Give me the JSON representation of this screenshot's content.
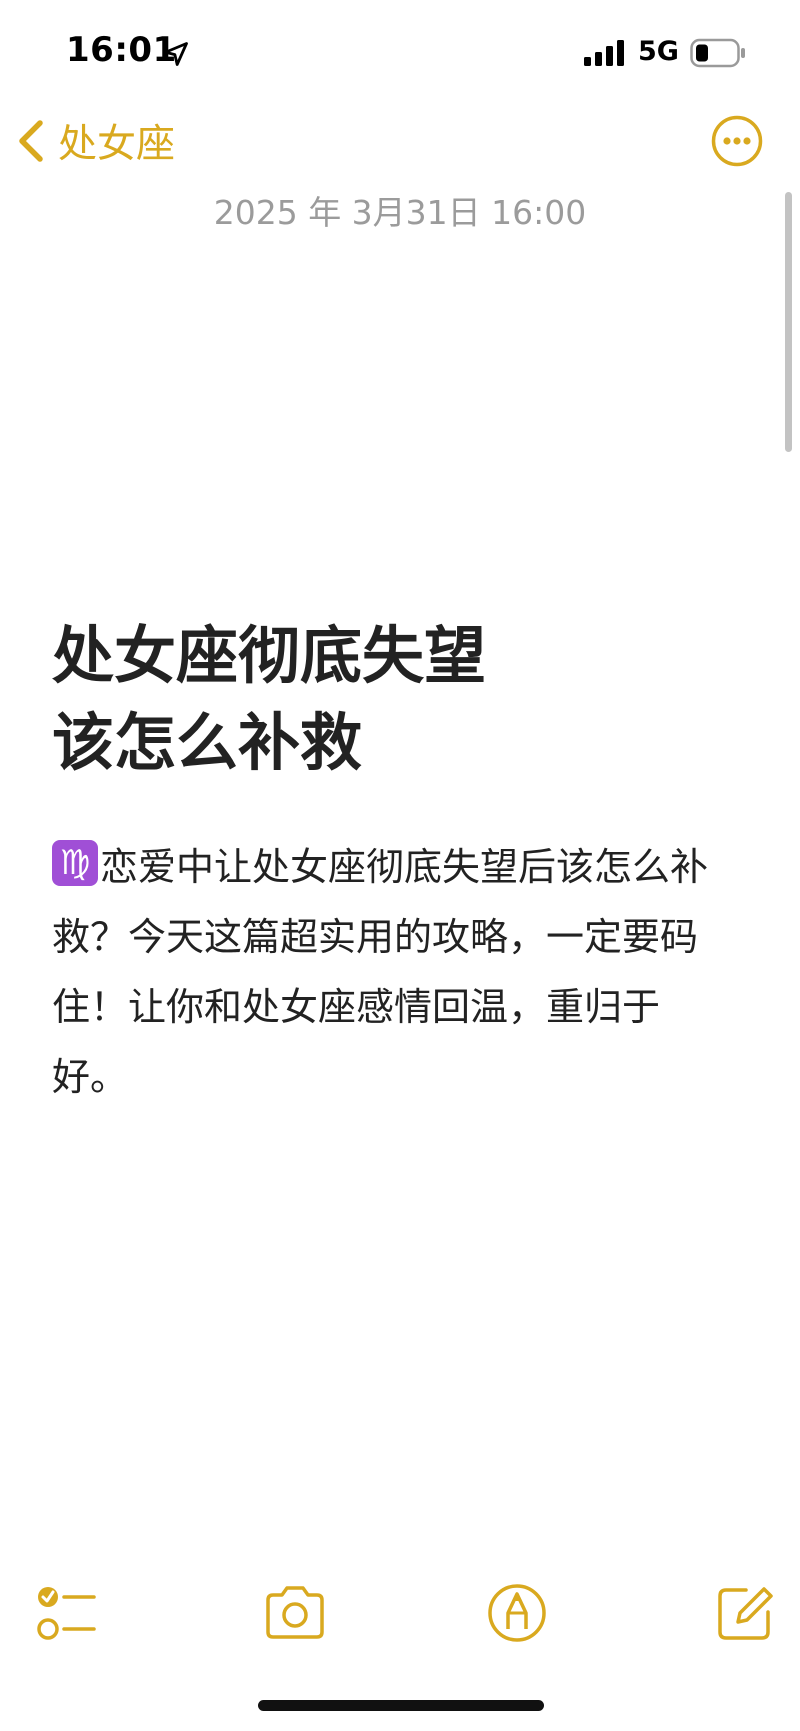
{
  "status_bar": {
    "time": "16:01",
    "network": "5G",
    "icons": [
      "location-arrow-icon",
      "cellular-signal-icon",
      "battery-icon"
    ]
  },
  "nav": {
    "back_label": "处女座",
    "back_icon": "chevron-left-icon",
    "more_icon": "ellipsis-circle-icon"
  },
  "note": {
    "date": "2025 年 3月31日 16:00",
    "title_lines": [
      "处女座彻底失望",
      "该怎么补救"
    ],
    "body_emoji": "♍",
    "body_lines": [
      "恋爱中让处女座彻底失望后该怎么补",
      "救？今天这篇超实用的攻略，一定要码",
      "住！让你和处女座感情回温，重归于",
      "好。"
    ]
  },
  "toolbar": {
    "items": [
      "checklist-icon",
      "camera-icon",
      "markup-pen-icon",
      "compose-icon"
    ]
  },
  "colors": {
    "accent": "#d9a91f",
    "date_text": "#9b9b9b",
    "body_text": "#222222",
    "zodiac_bg": "#a04fd6"
  }
}
